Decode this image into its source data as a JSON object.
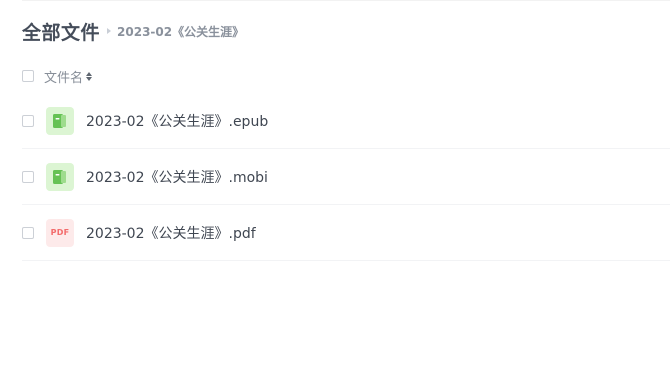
{
  "breadcrumb": {
    "root": "全部文件",
    "current": "2023-02《公关生涯》"
  },
  "list_header": {
    "name_column": "文件名"
  },
  "files": [
    {
      "name": "2023-02《公关生涯》.epub",
      "icon": "ebook-icon"
    },
    {
      "name": "2023-02《公关生涯》.mobi",
      "icon": "ebook-icon"
    },
    {
      "name": "2023-02《公关生涯》.pdf",
      "icon": "pdf-icon",
      "icon_text": "PDF"
    }
  ],
  "colors": {
    "ebook_icon_bg": "#dcf5d3",
    "ebook_icon_fg": "#66c255",
    "pdf_icon_bg": "#fdeaea",
    "pdf_icon_fg": "#f36b6b"
  }
}
